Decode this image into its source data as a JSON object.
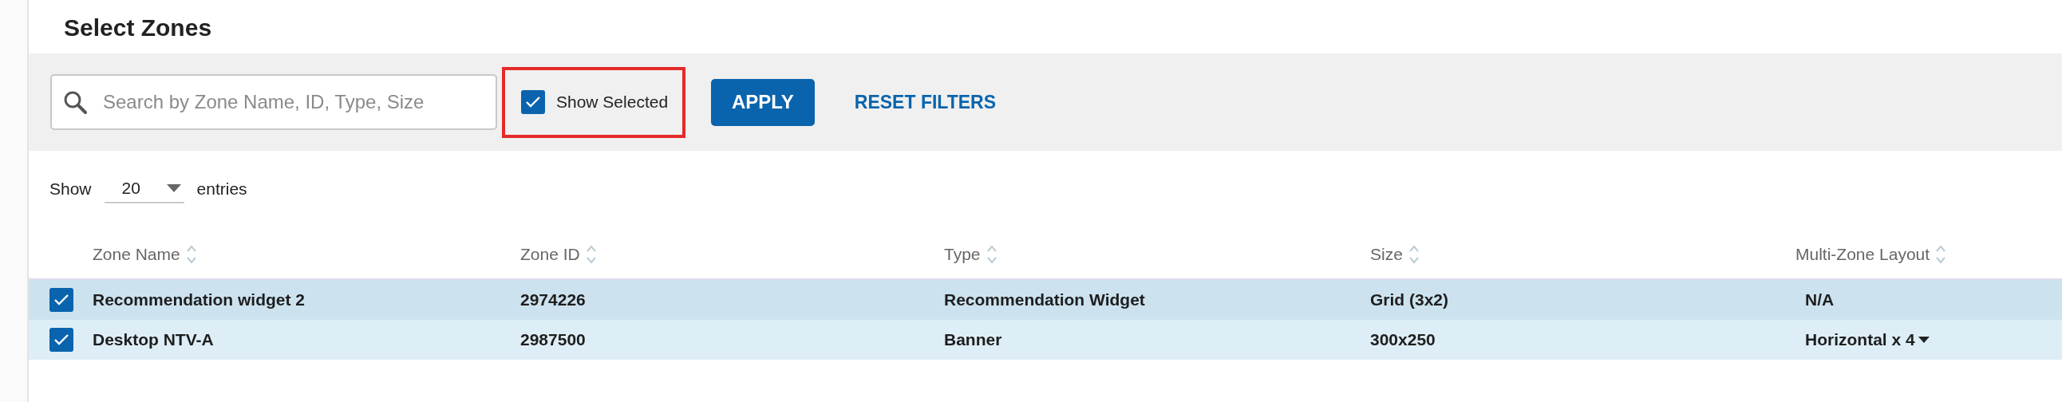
{
  "title": "Select Zones",
  "filters": {
    "search": {
      "placeholder": "Search by Zone Name, ID, Type, Size"
    },
    "show_selected": {
      "label": "Show Selected",
      "checked": true,
      "highlighted": true
    },
    "apply_button": "APPLY",
    "reset_link": "RESET FILTERS"
  },
  "page_length": {
    "prefix": "Show",
    "value": "20",
    "suffix": "entries"
  },
  "table": {
    "columns": [
      "Zone Name",
      "Zone ID",
      "Type",
      "Size",
      "Multi-Zone Layout"
    ],
    "rows": [
      {
        "selected": true,
        "cells": [
          "Recommendation widget 2",
          "2974226",
          "Recommendation Widget",
          "Grid (3x2)",
          "N/A"
        ],
        "layout_dropdown": false
      },
      {
        "selected": true,
        "cells": [
          "Desktop NTV-A",
          "2987500",
          "Banner",
          "300x250",
          "Horizontal x 4"
        ],
        "layout_dropdown": true
      }
    ]
  }
}
